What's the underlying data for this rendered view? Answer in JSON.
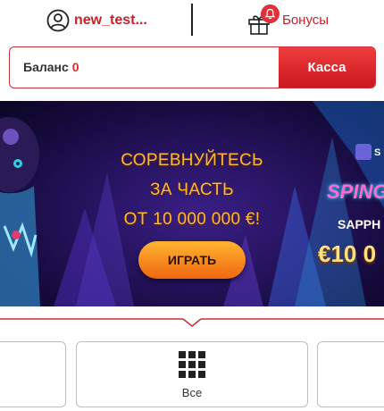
{
  "header": {
    "username": "new_test...",
    "user_icon": "user-circle-icon",
    "bonus_label": "Бонусы",
    "gift_icon": "gift-icon",
    "badge_icon": "bell-icon"
  },
  "balance": {
    "label": "Баланс",
    "value": "0",
    "cashier_label": "Касса"
  },
  "banner": {
    "promo_lines": [
      "СОРЕВНУЙТЕСЬ",
      "ЗА ЧАСТЬ",
      "ОТ 10 000 000 €!"
    ],
    "play_label": "ИГРАТЬ",
    "slot_small": "S",
    "slot_title": "SPING",
    "slot_sub": "SAPPH",
    "slot_amount": "€10 0"
  },
  "categories": {
    "all_label": "Все",
    "all_icon": "grid-icon"
  },
  "colors": {
    "brand_red": "#c8202b",
    "accent_orange": "#ffb829"
  }
}
